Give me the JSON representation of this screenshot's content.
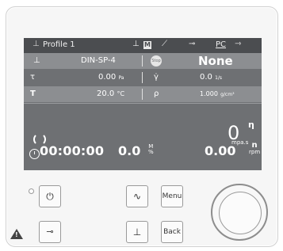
{
  "status_bar": {
    "title": "Profile 1",
    "badge": "M",
    "pc_label": "PC"
  },
  "rows": {
    "row1": {
      "left_value": "DIN-SP-4",
      "stop_label": "Stop",
      "right_value": "None"
    },
    "row2": {
      "left_label": "τ",
      "left_value": "0.00",
      "left_unit": "Pa",
      "right_label": "γ̇",
      "right_value": "0.0",
      "right_unit": "1/s"
    },
    "row3": {
      "left_label": "T",
      "left_value": "20.0",
      "left_unit": "°C",
      "right_label": "ρ",
      "right_value": "1.000",
      "right_unit": "g/cm³"
    }
  },
  "readout": {
    "viscosity_value": "0",
    "viscosity_symbol": "η",
    "viscosity_unit": "mpa.s",
    "timer": "00:00:00",
    "torque_value": "0.0",
    "torque_label_top": "M",
    "torque_label_bottom": "%",
    "speed_value": "0.00",
    "speed_symbol": "n",
    "speed_unit": "rpm"
  },
  "buttons": {
    "menu": "Menu",
    "back": "Back"
  },
  "icons": {
    "power": "power-icon",
    "graph": "graph-icon",
    "key": "key-icon",
    "spindle": "spindle-icon",
    "warning": "warning-icon"
  }
}
